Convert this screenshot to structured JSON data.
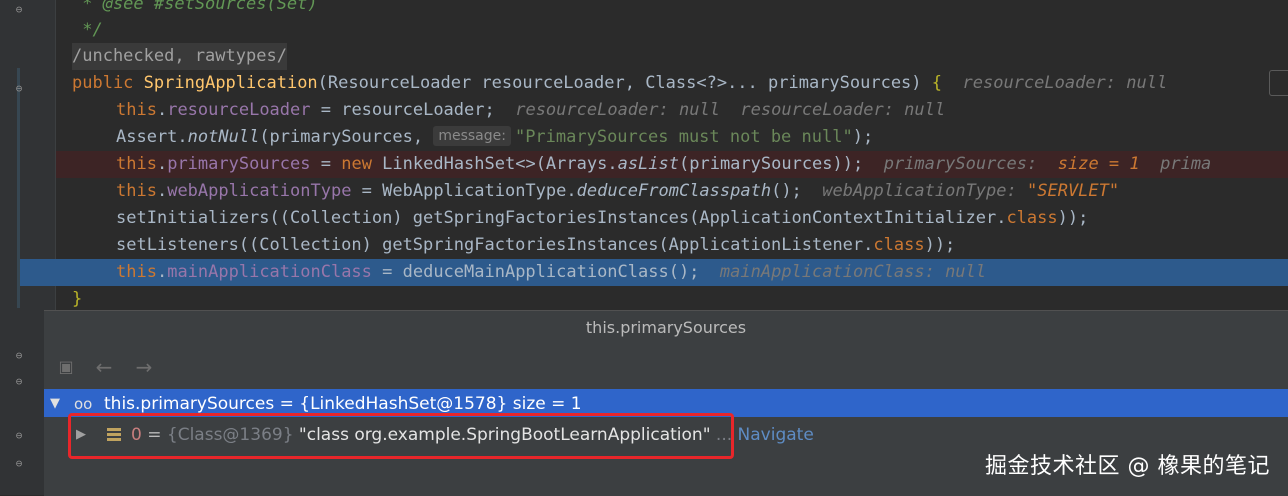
{
  "editor": {
    "lines": [
      {
        "comment_see": " * @see #setSources(Set)"
      },
      {
        "comment_end": " */"
      },
      {
        "annotation": "/unchecked, rawtypes/"
      },
      {
        "kw_public": "public",
        "ctor_name": "SpringApplication",
        "params": "(ResourceLoader resourceLoader, Class<?>... primarySources) ",
        "brace": "{",
        "hint": "resourceLoader: null"
      },
      {
        "kw_this": "this",
        "field": "resourceLoader",
        "rest": " = resourceLoader;",
        "hint1": "resourceLoader: null",
        "hint2": "resourceLoader: null"
      },
      {
        "pre": "Assert.",
        "method": "notNull",
        "args": "(primarySources, ",
        "param_hint": "message:",
        "string": "\"PrimarySources must not be null\"",
        "end": ");"
      },
      {
        "kw_this": "this",
        "field": "primarySources",
        "eq": " = ",
        "kw_new": "new",
        "mid": " LinkedHashSet<>(Arrays.",
        "method": "asList",
        "end": "(primarySources));",
        "hint_name": "primarySources:",
        "hint_size": "size = 1",
        "hint_more": "prima"
      },
      {
        "kw_this": "this",
        "field": "webApplicationType",
        "mid": " = WebApplicationType.",
        "method": "deduceFromClasspath",
        "end": "();",
        "hint_name": "webApplicationType:",
        "hint_val": "\"SERVLET\""
      },
      {
        "pre": "setInitializers((Collection) getSpringFactoriesInstances(ApplicationContextInitializer.",
        "kw_class": "class",
        "end": "));"
      },
      {
        "pre": "setListeners((Collection) getSpringFactoriesInstances(ApplicationListener.",
        "kw_class": "class",
        "end": "));"
      },
      {
        "kw_this": "this",
        "field": "mainApplicationClass",
        "rest": " = deduceMainApplicationClass();",
        "hint": "mainApplicationClass: null"
      },
      {
        "brace": "}"
      }
    ]
  },
  "popup": {
    "title": "this.primarySources",
    "root": {
      "text": "this.primarySources = {LinkedHashSet@1578}  size = 1"
    },
    "child": {
      "index": "0",
      "eq": " = ",
      "class_ref": "{Class@1369}",
      "value": " \"class org.example.SpringBootLearnApplication\"",
      "ellipsis": " ...",
      "navigate": " Navigate"
    }
  },
  "watermark": "掘金技术社区 @ 橡果的笔记",
  "icons": [
    "fold-icon",
    "back-arrow-icon",
    "forward-arrow-icon",
    "watch-glasses-icon",
    "field-icon",
    "expand-arrow-icon"
  ],
  "colors": {
    "background": "#2b2b2b",
    "keyword": "#cc7832",
    "field": "#9876aa",
    "method": "#ffc66d",
    "string": "#6a8759",
    "selection": "#2d5a8c",
    "error_line": "#3d2425",
    "tree_selection": "#2f65ca",
    "highlight_box": "#e8262a"
  }
}
